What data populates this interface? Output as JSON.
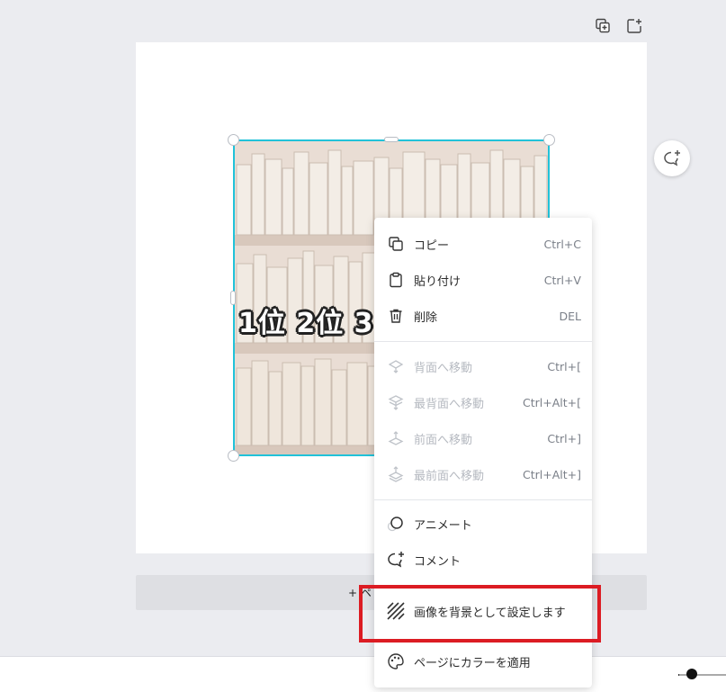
{
  "top_actions": {
    "duplicate_icon": "duplicate-page-icon",
    "add_page_icon": "add-page-icon"
  },
  "canvas": {
    "image_overlay_text": "1位 2位 3",
    "add_page_label": "+ ペ"
  },
  "context_menu": {
    "copy": {
      "label": "コピー",
      "shortcut": "Ctrl+C"
    },
    "paste": {
      "label": "貼り付け",
      "shortcut": "Ctrl+V"
    },
    "delete": {
      "label": "削除",
      "shortcut": "DEL"
    },
    "send_backward": {
      "label": "背面へ移動",
      "shortcut": "Ctrl+["
    },
    "send_to_back": {
      "label": "最背面へ移動",
      "shortcut": "Ctrl+Alt+["
    },
    "bring_forward": {
      "label": "前面へ移動",
      "shortcut": "Ctrl+]"
    },
    "bring_to_front": {
      "label": "最前面へ移動",
      "shortcut": "Ctrl+Alt+]"
    },
    "animate": {
      "label": "アニメート"
    },
    "comment": {
      "label": "コメント"
    },
    "set_as_background": {
      "label": "画像を背景として設定します"
    },
    "apply_color": {
      "label": "ページにカラーを適用"
    }
  },
  "colors": {
    "selection": "#21c2d9",
    "highlight": "#dc1c23"
  }
}
